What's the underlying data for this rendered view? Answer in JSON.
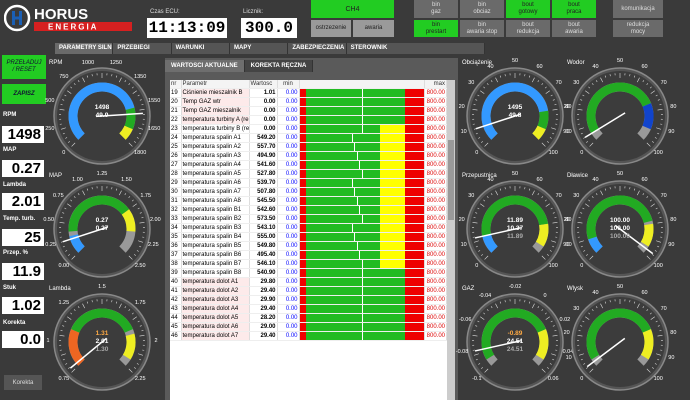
{
  "brand": {
    "name": "HORUS",
    "sub": "ENERGIA"
  },
  "header": {
    "time_label": "Czas ECU:",
    "time": "11:13:09",
    "counter_label": "Licznik:",
    "counter": "300.0"
  },
  "buttons": {
    "ch4": "CH4",
    "ostrzezenie": "ostrzezenie",
    "awaria": "awaria",
    "bin_gaz": "bin\ngaz",
    "bin_obciaz": "bin\nobciaz",
    "bin_prestart": "bin\nprestart",
    "bin_awaria_stop": "bin\nawaria stop",
    "bout_gotowy": "bout\ngotowy",
    "bout_praca": "bout\npraca",
    "bout_redukcja": "bout\nredukcja",
    "bout_awaria": "bout\nawaria",
    "komunikacja": "komunikacja",
    "redukcja_mocy": "redukcja\nmocy"
  },
  "tabs": [
    "PARAMETRY SILNIKA",
    "PRZEBIEGI",
    "WARUNKI",
    "MAPY",
    "ZABEZPIECZENIA",
    "STEROWNIK"
  ],
  "left": {
    "przeladuj": "PRZEŁADUJ\n/ RESET",
    "zapisz": "ZAPISZ",
    "params": [
      {
        "label": "RPM",
        "value": "1498"
      },
      {
        "label": "MAP",
        "value": "0.27"
      },
      {
        "label": "Lambda",
        "value": "2.01"
      },
      {
        "label": "Temp. turb.",
        "value": "25"
      },
      {
        "label": "Przep. %",
        "value": "11.9"
      },
      {
        "label": "Stuk",
        "value": "1.02"
      },
      {
        "label": "Korekta",
        "value": "0.0"
      }
    ],
    "korekta_btn": "Korekta"
  },
  "gauges": {
    "rpm": {
      "title": "RPM",
      "ticks": [
        "0",
        "250",
        "500",
        "750",
        "1000",
        "1250",
        "1350",
        "1550",
        "1650",
        "1800"
      ],
      "v1": "1498",
      "v2": "49.9"
    },
    "map": {
      "title": "MAP",
      "ticks": [
        "0.00",
        "0.25",
        "0.50",
        "0.75",
        "1.00",
        "1.25",
        "1.50",
        "1.75",
        "2.00",
        "2.25",
        "2.50"
      ],
      "v1": "0.27",
      "v2": "0.27"
    },
    "lambda": {
      "title": "Lambda",
      "ticks": [
        "0.75",
        "1",
        "1.25",
        "1.5",
        "1.75",
        "2",
        "2.25"
      ],
      "v1": "1.31",
      "v2": "2.01",
      "v3": "1.30"
    },
    "obc": {
      "title": "Obciążenie",
      "ticks": [
        "0",
        "10",
        "20",
        "30",
        "40",
        "50",
        "60",
        "70",
        "80",
        "90",
        "100"
      ],
      "v1": "1495",
      "v2": "49.8"
    },
    "wodor": {
      "title": "Wodor",
      "ticks": [
        "0",
        "10",
        "20",
        "30",
        "40",
        "50",
        "60",
        "70",
        "80",
        "90",
        "100"
      ]
    },
    "przep": {
      "title": "Przepustnica",
      "ticks": [
        "0",
        "10",
        "20",
        "30",
        "40",
        "50",
        "60",
        "70",
        "80",
        "90",
        "100"
      ],
      "v1": "11.89",
      "v2": "10.37",
      "v3": "11.89"
    },
    "dlawice": {
      "title": "Dławice",
      "ticks": [
        "0",
        "10",
        "20",
        "30",
        "40",
        "50",
        "60",
        "70",
        "80",
        "90",
        "100"
      ],
      "v1": "100.00",
      "v2": "100.00",
      "v3": "100.00"
    },
    "gaz": {
      "title": "GAZ",
      "ticks": [
        "-0.1",
        "-0.08",
        "-0.06",
        "-0.04",
        "-0.02",
        "0",
        "0.02",
        "0.04",
        "0.06"
      ],
      "v1": "-0.89",
      "v2": "24.51",
      "v3": "24.51"
    },
    "wlot": {
      "title": "Wlysk",
      "ticks": [
        "0",
        "10",
        "20",
        "30",
        "40",
        "50",
        "60",
        "70",
        "80",
        "90",
        "100"
      ]
    }
  },
  "panel": {
    "tabs": [
      "WARTOSCI AKTUALNE",
      "KOREKTA RĘCZNA"
    ],
    "cols": {
      "nr": "nr",
      "par": "Parametr",
      "val": "Wartosc",
      "min": "min",
      "max": "max"
    },
    "rows": [
      {
        "nr": "19",
        "par": "Ciśnienie mieszalnik B",
        "val": "1.01",
        "min": "0.00",
        "max": "800.00",
        "p": 0.6
      },
      {
        "nr": "20",
        "par": "Temp GAZ wtr",
        "val": "0.00",
        "min": "0.00",
        "max": "800.00",
        "p": 0.6
      },
      {
        "nr": "21",
        "par": "Temp GAZ mieszalnik",
        "val": "0.00",
        "min": "0.00",
        "max": "800.00",
        "p": 0.6
      },
      {
        "nr": "22",
        "par": "temperatura turbiny A (re",
        "val": "0.00",
        "min": "0.00",
        "max": "800.00",
        "p": 0.6
      },
      {
        "nr": "23",
        "par": "temperatura turbiny B (re",
        "val": "0.00",
        "min": "0.00",
        "max": "800.00",
        "p": 0.6
      },
      {
        "nr": "24",
        "par": "temperatura spalin A1",
        "val": "549.20",
        "min": "0.00",
        "max": "800.00",
        "p": 0.6
      },
      {
        "nr": "25",
        "par": "temperatura spalin A2",
        "val": "557.70",
        "min": "0.00",
        "max": "800.00",
        "p": 0.6
      },
      {
        "nr": "26",
        "par": "temperatura spalin A3",
        "val": "494.90",
        "min": "0.00",
        "max": "800.00",
        "p": 0.6
      },
      {
        "nr": "27",
        "par": "temperatura spalin A4",
        "val": "541.60",
        "min": "0.00",
        "max": "800.00",
        "p": 0.6
      },
      {
        "nr": "28",
        "par": "temperatura spalin A5",
        "val": "527.80",
        "min": "0.00",
        "max": "800.00",
        "p": 0.6
      },
      {
        "nr": "29",
        "par": "temperatura spalin A6",
        "val": "539.70",
        "min": "0.00",
        "max": "800.00",
        "p": 0.6
      },
      {
        "nr": "30",
        "par": "temperatura spalin A7",
        "val": "507.80",
        "min": "0.00",
        "max": "800.00",
        "p": 0.6
      },
      {
        "nr": "31",
        "par": "temperatura spalin A8",
        "val": "545.50",
        "min": "0.00",
        "max": "800.00",
        "p": 0.6
      },
      {
        "nr": "32",
        "par": "temperatura spalin B1",
        "val": "542.60",
        "min": "0.00",
        "max": "800.00",
        "p": 0.6
      },
      {
        "nr": "33",
        "par": "temperatura spalin B2",
        "val": "573.50",
        "min": "0.00",
        "max": "800.00",
        "p": 0.6
      },
      {
        "nr": "34",
        "par": "temperatura spalin B3",
        "val": "543.10",
        "min": "0.00",
        "max": "800.00",
        "p": 0.6
      },
      {
        "nr": "35",
        "par": "temperatura spalin B4",
        "val": "555.00",
        "min": "0.00",
        "max": "800.00",
        "p": 0.6
      },
      {
        "nr": "36",
        "par": "temperatura spalin B5",
        "val": "549.80",
        "min": "0.00",
        "max": "800.00",
        "p": 0.6
      },
      {
        "nr": "37",
        "par": "temperatura spalin B6",
        "val": "495.40",
        "min": "0.00",
        "max": "800.00",
        "p": 0.6
      },
      {
        "nr": "38",
        "par": "temperatura spalin B7",
        "val": "546.10",
        "min": "0.00",
        "max": "800.00",
        "p": 0.6
      },
      {
        "nr": "39",
        "par": "temperatura spalin B8",
        "val": "540.90",
        "min": "0.00",
        "max": "800.00",
        "p": 0.6
      },
      {
        "nr": "40",
        "par": "temperatura dolot A1",
        "val": "29.80",
        "min": "0.00",
        "max": "800.00",
        "p": 0.7
      },
      {
        "nr": "41",
        "par": "temperatura dolot A2",
        "val": "29.40",
        "min": "0.00",
        "max": "800.00",
        "p": 0.7
      },
      {
        "nr": "42",
        "par": "temperatura dolot A3",
        "val": "29.90",
        "min": "0.00",
        "max": "800.00",
        "p": 0.7
      },
      {
        "nr": "43",
        "par": "temperatura dolot A4",
        "val": "29.40",
        "min": "0.00",
        "max": "800.00",
        "p": 0.7
      },
      {
        "nr": "44",
        "par": "temperatura dolot A5",
        "val": "28.20",
        "min": "0.00",
        "max": "800.00",
        "p": 0.7
      },
      {
        "nr": "45",
        "par": "temperatura dolot A6",
        "val": "29.00",
        "min": "0.00",
        "max": "800.00",
        "p": 0.7
      },
      {
        "nr": "46",
        "par": "temperatura dolot A7",
        "val": "29.40",
        "min": "0.00",
        "max": "800.00",
        "p": 0.7
      }
    ]
  }
}
